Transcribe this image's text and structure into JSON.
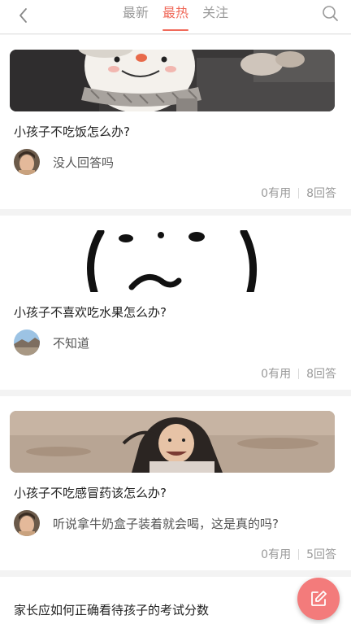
{
  "header": {
    "back_icon": "chevron-left-icon",
    "search_icon": "search-icon",
    "tabs": [
      {
        "label": "最新",
        "active": false
      },
      {
        "label": "最热",
        "active": true
      },
      {
        "label": "关注",
        "active": false
      }
    ],
    "accent_color": "#f06a5a"
  },
  "questions": [
    {
      "title": "小孩子不吃饭怎么办?",
      "thumbnail": "snowman-photo",
      "answer_avatar": "child-portrait-avatar",
      "answer_preview": "没人回答吗",
      "useful_count": "0有用",
      "answer_count": "8回答"
    },
    {
      "title": "小孩子不喜欢吃水果怎么办?",
      "thumbnail": "cartoon-face-sketch",
      "answer_avatar": "landscape-avatar",
      "answer_preview": "不知道",
      "useful_count": "0有用",
      "answer_count": "8回答"
    },
    {
      "title": "小孩子不吃感冒药该怎么办?",
      "thumbnail": "girl-on-beach-photo",
      "answer_avatar": "child-portrait-avatar",
      "answer_preview": "听说拿牛奶盒子装着就会喝，这是真的吗?",
      "useful_count": "0有用",
      "answer_count": "5回答"
    },
    {
      "title": "家长应如何正确看待孩子的考试分数"
    }
  ],
  "fab": {
    "icon": "edit-icon",
    "color": "#f37b7b"
  }
}
